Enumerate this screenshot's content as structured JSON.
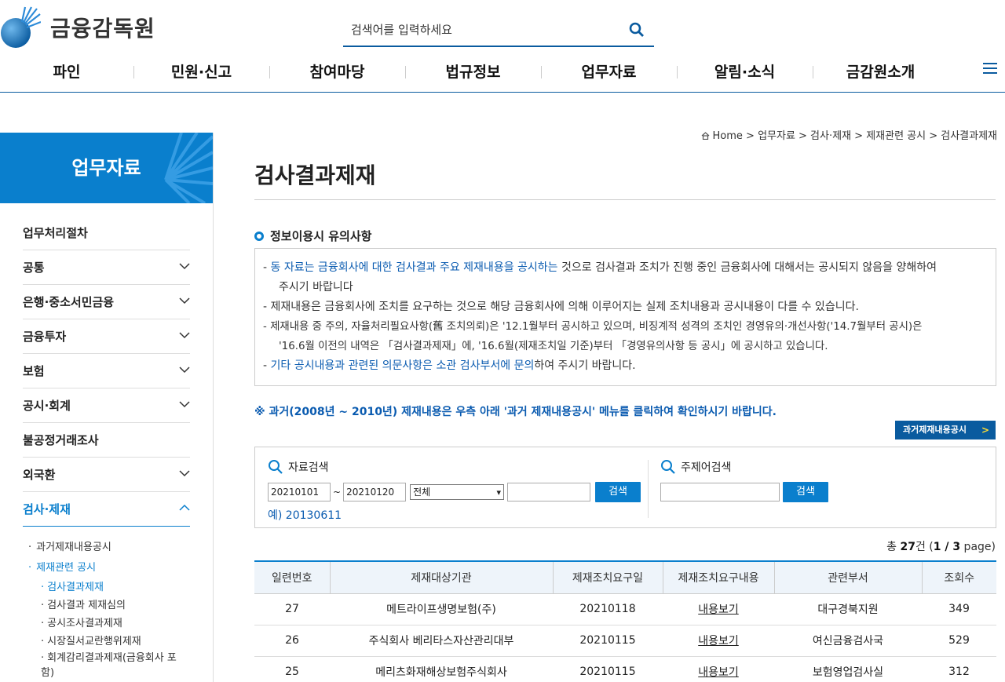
{
  "header": {
    "logo_text": "금융감독원",
    "search_placeholder": "검색어를 입력하세요",
    "nav": [
      "파인",
      "민원·신고",
      "참여마당",
      "법규정보",
      "업무자료",
      "알림·소식",
      "금감원소개"
    ]
  },
  "sidebar": {
    "title": "업무자료",
    "items": [
      {
        "label": "업무처리절차"
      },
      {
        "label": "공통"
      },
      {
        "label": "은행·중소서민금융"
      },
      {
        "label": "금융투자"
      },
      {
        "label": "보험"
      },
      {
        "label": "공시·회계"
      },
      {
        "label": "불공정거래조사"
      },
      {
        "label": "외국환"
      },
      {
        "label": "검사·제재"
      }
    ],
    "sub": {
      "past": "과거제재내용공시",
      "related": "제재관련 공시",
      "children": [
        "검사결과제재",
        "검사결과 제재심의",
        "공시조사결과제재",
        "시장질서교란행위제재",
        "회계감리결과제재(금융회사 포함)"
      ]
    }
  },
  "content": {
    "breadcrumb": "Home > 업무자료 > 검사·제재 > 제재관련 공시 > 검사결과제재",
    "title": "검사결과제재",
    "notice_title": "정보이용시 유의사항",
    "notice": {
      "line1_blue": "동 자료는 금융회사에 대한 검사결과 주요 제재내용을 공시하는",
      "line1_rest": " 것으로 검사결과 조치가 진행 중인 금융회사에 대해서는 공시되지 않음을 양해하여",
      "line1_cont": "주시기 바랍니다",
      "line2": "제재내용은 금융회사에 조치를 요구하는 것으로 해당 금융회사에 의해 이루어지는 실제 조치내용과 공시내용이 다를 수 있습니다.",
      "line3a": "제재내용 중 주의, 자율처리필요사항(舊 조치의뢰)은 '12.1월부터 공시하고 있으며, 비징계적 성격의 조치인 경영유의·개선사항('14.7월부터 공시)은",
      "line3b": "'16.6월 이전의 내역은 「검사결과제재」에, '16.6월(제재조치일 기준)부터 「경영유의사항 등 공시」에 공시하고 있습니다.",
      "line4_blue": "기타 공시내용과 관련된 의문사항은 소관 검사부서에 문의",
      "line4_rest": "하여 주시기 바랍니다."
    },
    "past_msg": "※ 과거(2008년 ~ 2010년) 제재내용은 우측 아래 '과거 제재내용공시' 메뉴를 클릭하여 확인하시기 바랍니다.",
    "past_btn": "과거제재내용공시",
    "search": {
      "left_label": "자료검색",
      "date_from": "20210101",
      "date_sep": "~",
      "date_to": "20210120",
      "select_value": "전체",
      "keyword": "",
      "button": "검색",
      "example": "예) 20130611",
      "right_label": "주제어검색",
      "right_button": "검색"
    },
    "count_prefix": "총 ",
    "count_total": "27",
    "count_mid": "건 (",
    "count_page": "1 / 3",
    "count_suffix": " page)",
    "table": {
      "headers": [
        "일련번호",
        "제재대상기관",
        "제재조치요구일",
        "제재조치요구내용",
        "관련부서",
        "조회수"
      ],
      "rows": [
        [
          "27",
          "메트라이프생명보험(주)",
          "20210118",
          "내용보기",
          "대구경북지원",
          "349"
        ],
        [
          "26",
          "주식회사 베리타스자산관리대부",
          "20210115",
          "내용보기",
          "여신금융검사국",
          "529"
        ],
        [
          "25",
          "메리츠화재해상보험주식회사",
          "20210115",
          "내용보기",
          "보험영업검사실",
          "312"
        ]
      ]
    }
  },
  "colors": {
    "primary": "#0a7fcd",
    "dark_blue": "#0a5b9f",
    "link_blue": "#0a5bb0"
  }
}
